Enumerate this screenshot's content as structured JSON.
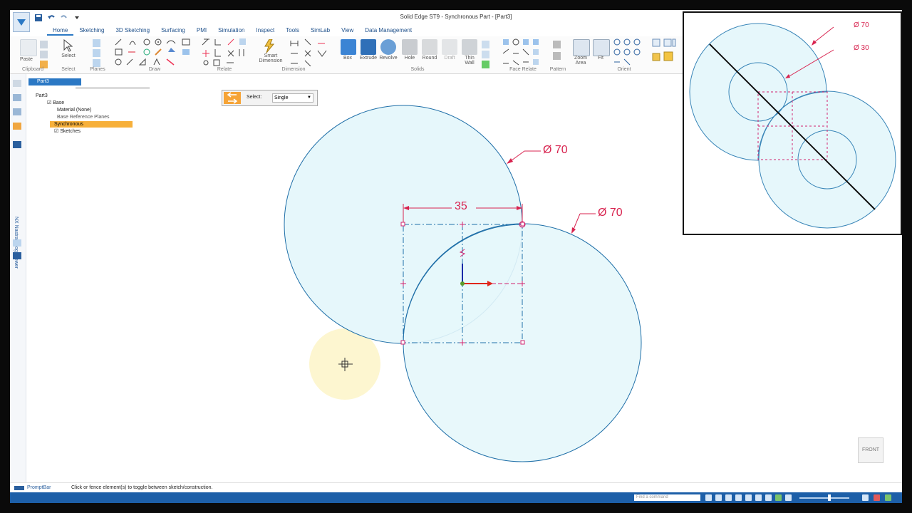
{
  "window": {
    "title": "Solid Edge ST9 - Synchronous Part - [Part3]"
  },
  "ribbon": {
    "tabs": [
      "Home",
      "Sketching",
      "3D Sketching",
      "Surfacing",
      "PMI",
      "Simulation",
      "Inspect",
      "Tools",
      "SimLab",
      "View",
      "Data Management"
    ],
    "active_tab": "Home",
    "groups": {
      "clipboard": "Clipboard",
      "select": "Select",
      "planes": "Planes",
      "draw": "Draw",
      "relate": "Relate",
      "dimension": "Dimension",
      "solids": "Solids",
      "face_relate": "Face Relate",
      "pattern": "Pattern",
      "orient": "Orient"
    },
    "buttons": {
      "paste": "Paste",
      "select": "Select",
      "smart_dimension": "Smart\nDimension",
      "box": "Box",
      "extrude": "Extrude",
      "revolve": "Revolve",
      "hole": "Hole",
      "round": "Round",
      "draft": "Draft",
      "thin_wall": "Thin\nWall",
      "zoom_area": "Zoom\nArea",
      "fit": "Fit"
    }
  },
  "pathfinder": {
    "tab": "Part3",
    "items": [
      "Base",
      "Material (None)",
      "Base Reference Planes",
      "Synchronous",
      "Sketches"
    ]
  },
  "left_rail": {
    "vertical_label": "NX Nastran Log Viewer"
  },
  "select_toolbar": {
    "label": "Select:",
    "value": "Single"
  },
  "drawing": {
    "dim_width": "35",
    "dim_dia_top": "Ø 70",
    "dim_dia_bottom": "Ø 70"
  },
  "inset": {
    "dim_dia_large": "Ø 70",
    "dim_dia_small": "Ø 30"
  },
  "view_cube": {
    "label": "FRONT"
  },
  "prompt_bar": {
    "label": "PromptBar",
    "text": "Click or fence element(s) to toggle between sketch/construction."
  },
  "status_bar": {
    "find_placeholder": "Find a command"
  },
  "colors": {
    "circle_fill": "#e6f7fb",
    "circle_stroke": "#1f6fa8",
    "construction": "#d2236f",
    "dimension": "#d8234f",
    "status_bar": "#1d5fa8",
    "highlight_tree": "#f7b03a"
  }
}
